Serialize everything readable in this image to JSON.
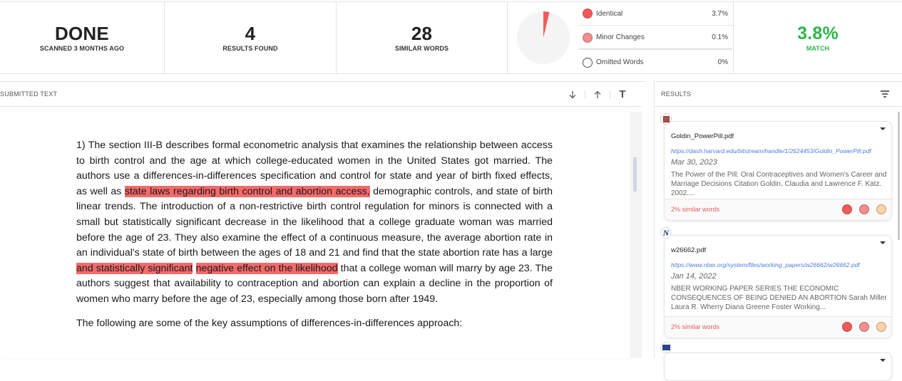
{
  "stats": {
    "status": {
      "value": "DONE",
      "label": "SCANNED 3 MONTHS AGO"
    },
    "results": {
      "value": "4",
      "label": "RESULTS FOUND"
    },
    "similar_words": {
      "value": "28",
      "label": "SIMILAR WORDS"
    },
    "breakdown": [
      {
        "label": "Identical",
        "percent": "3.7%",
        "color": "#f25a5a"
      },
      {
        "label": "Minor Changes",
        "percent": "0.1%",
        "color": "#f48d8d"
      },
      {
        "label": "Omitted Words",
        "percent": "0%",
        "color": "#ffffff"
      }
    ],
    "pie": {
      "identical": 3.7,
      "minor_changes": 0.1,
      "omitted": 0,
      "match_color": "#f25a5a",
      "rest_color": "#f4f4f4"
    },
    "match": {
      "value": "3.8%",
      "label": "MATCH",
      "color": "#2cb54a"
    }
  },
  "submitted_text": {
    "header": "SUBMITTED TEXT",
    "tools": {
      "next": "next-match",
      "prev": "previous-match",
      "text": "T"
    },
    "paragraphs": [
      [
        {
          "t": "1) The section III-B describes formal econometric analysis that examines the relationship between access to birth control and the age at which college-educated women in the United States got married. The authors use a differences-in-differences specification and control for state and year of birth fixed effects, as well as ",
          "hl": false
        },
        {
          "t": "state laws regarding birth control and abortion access,",
          "hl": true
        },
        {
          "t": " demographic controls, and state of birth linear trends. The introduction of a non-restrictive birth control regulation for minors is connected with a small but statistically significant decrease in the likelihood that a college graduate woman was married before the age of 23. They also examine the effect of a continuous measure, the average abortion rate in an individual's state of birth between the ages of 18 and 21 and find that the state abortion rate has a large ",
          "hl": false
        },
        {
          "t": "and statistically significant",
          "hl": true
        },
        {
          "t": " ",
          "hl": false
        },
        {
          "t": "negative effect on the likelihood",
          "hl": true
        },
        {
          "t": " that a college woman will marry by age 23. The authors suggest that availability to contraception and abortion can explain a decline in the proportion of women who marry before the age of 23, especially among those born after 1949.",
          "hl": false
        }
      ],
      [
        {
          "t": "The following are some of the key assumptions of differences-in-differences approach:",
          "hl": false
        }
      ]
    ]
  },
  "results": {
    "header": "RESULTS",
    "items": [
      {
        "source_icon": "harvard-icon",
        "filename": "Goldin_PowerPill.pdf",
        "url": "https://dash.harvard.edu/bitstream/handle/1/2624453/Goldin_PowerPill.pdf",
        "date": "Mar 30, 2023",
        "excerpt": "The Power of the Pill: Oral Contraceptives and Women's Career and Marriage Decisions Citation Goldin, Claudia and Lawrence F. Katz. 2002....",
        "similarity": "2% similar words"
      },
      {
        "source_icon": "nber-icon",
        "filename": "w26662.pdf",
        "url": "https://www.nber.org/system/files/working_papers/w26662/w26662.pdf",
        "date": "Jan 14, 2022",
        "excerpt": "NBER WORKING PAPER SERIES THE ECONOMIC CONSEQUENCES OF BEING DENIED AN ABORTION Sarah Miller Laura R. Wherry Diana Greene Foster Working...",
        "similarity": "2% similar words"
      },
      {
        "source_icon": "ssrn-icon"
      }
    ]
  }
}
